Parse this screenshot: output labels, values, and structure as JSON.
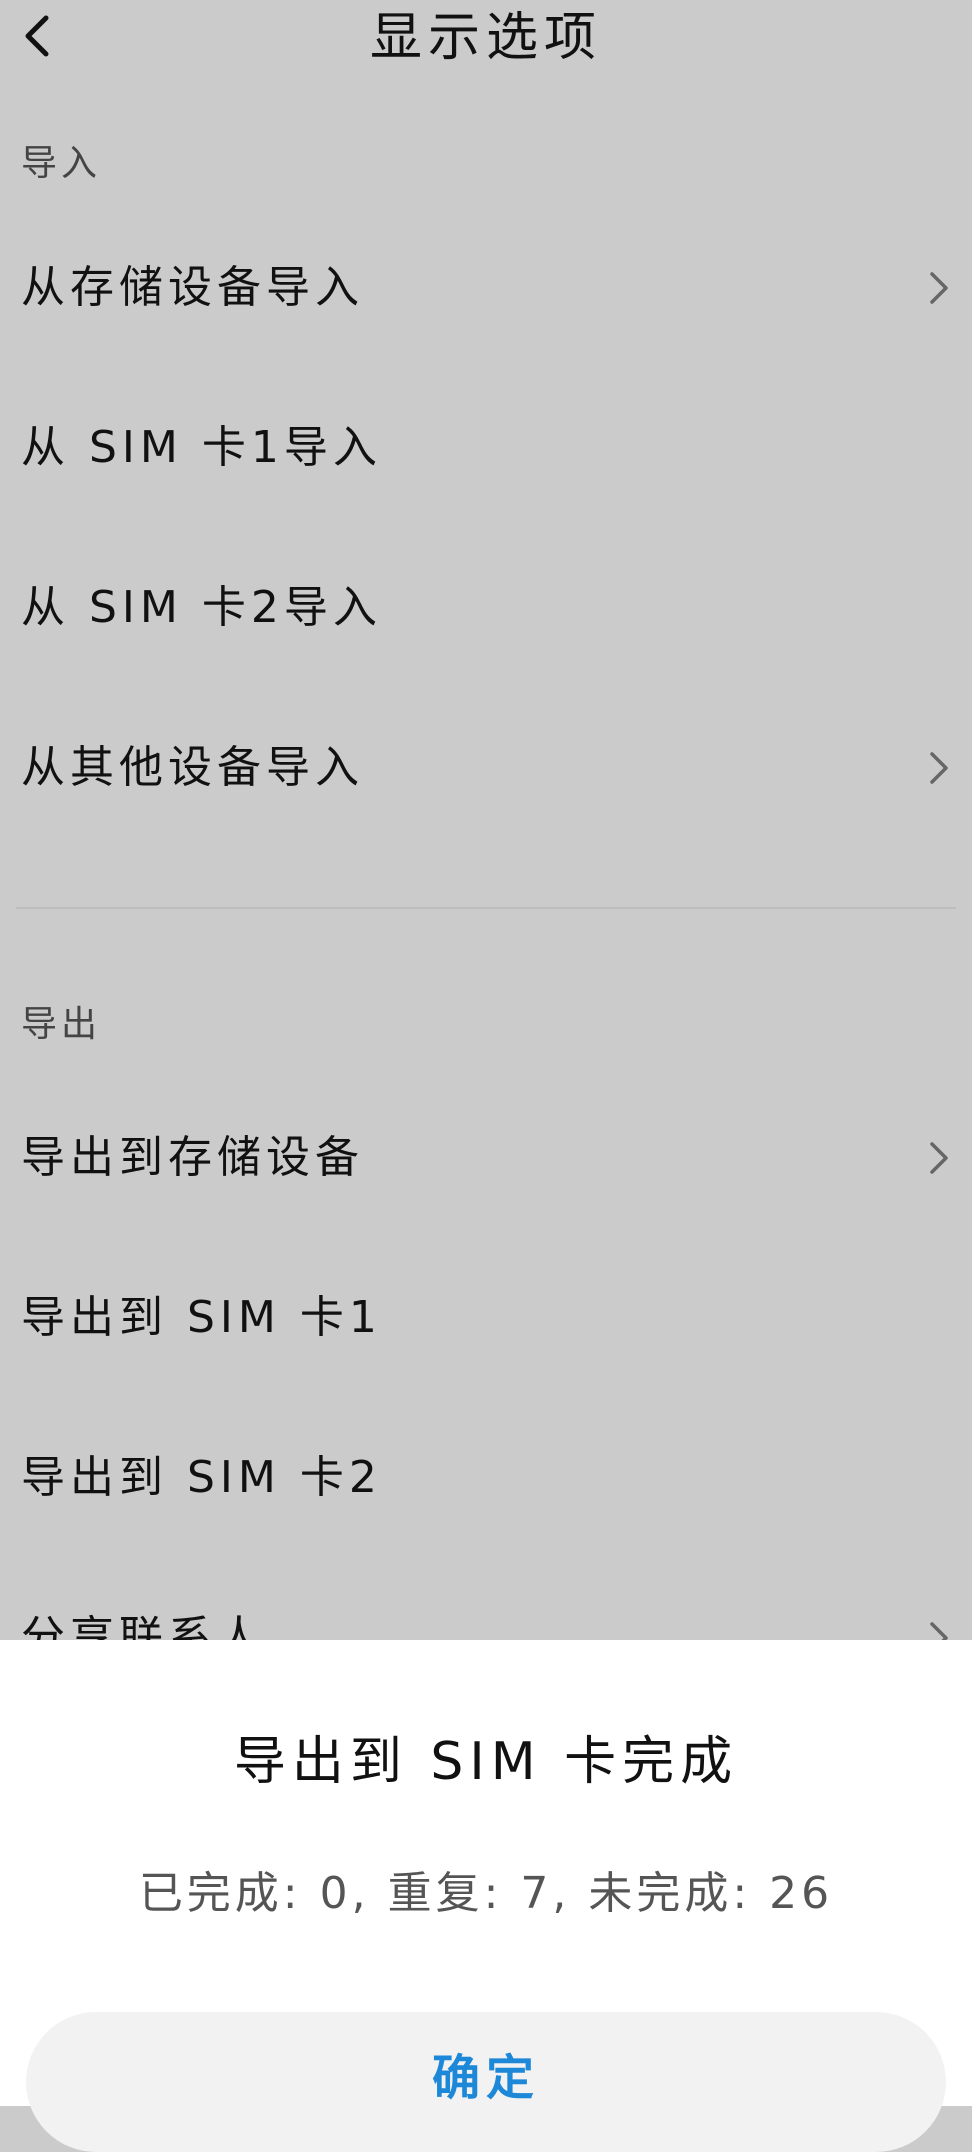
{
  "header": {
    "title": "显示选项",
    "back_icon": "chevron-left-icon"
  },
  "import_section": {
    "title": "导入",
    "items": [
      {
        "label": "从存储设备导入",
        "has_chevron": true
      },
      {
        "label": "从 SIM 卡1导入",
        "has_chevron": false
      },
      {
        "label": "从 SIM 卡2导入",
        "has_chevron": false
      },
      {
        "label": "从其他设备导入",
        "has_chevron": true
      }
    ]
  },
  "export_section": {
    "title": "导出",
    "items": [
      {
        "label": "导出到存储设备",
        "has_chevron": true
      },
      {
        "label": "导出到 SIM 卡1",
        "has_chevron": false
      },
      {
        "label": "导出到 SIM 卡2",
        "has_chevron": false
      },
      {
        "label": "分享联系人",
        "has_chevron": true
      }
    ]
  },
  "dialog": {
    "title": "导出到 SIM 卡完成",
    "message": "已完成: 0, 重复: 7, 未完成: 26",
    "confirm_label": "确定"
  },
  "colors": {
    "background": "#cbcbcb",
    "sheet": "#ffffff",
    "button": "#f2f2f2",
    "accent": "#1e88d8"
  }
}
